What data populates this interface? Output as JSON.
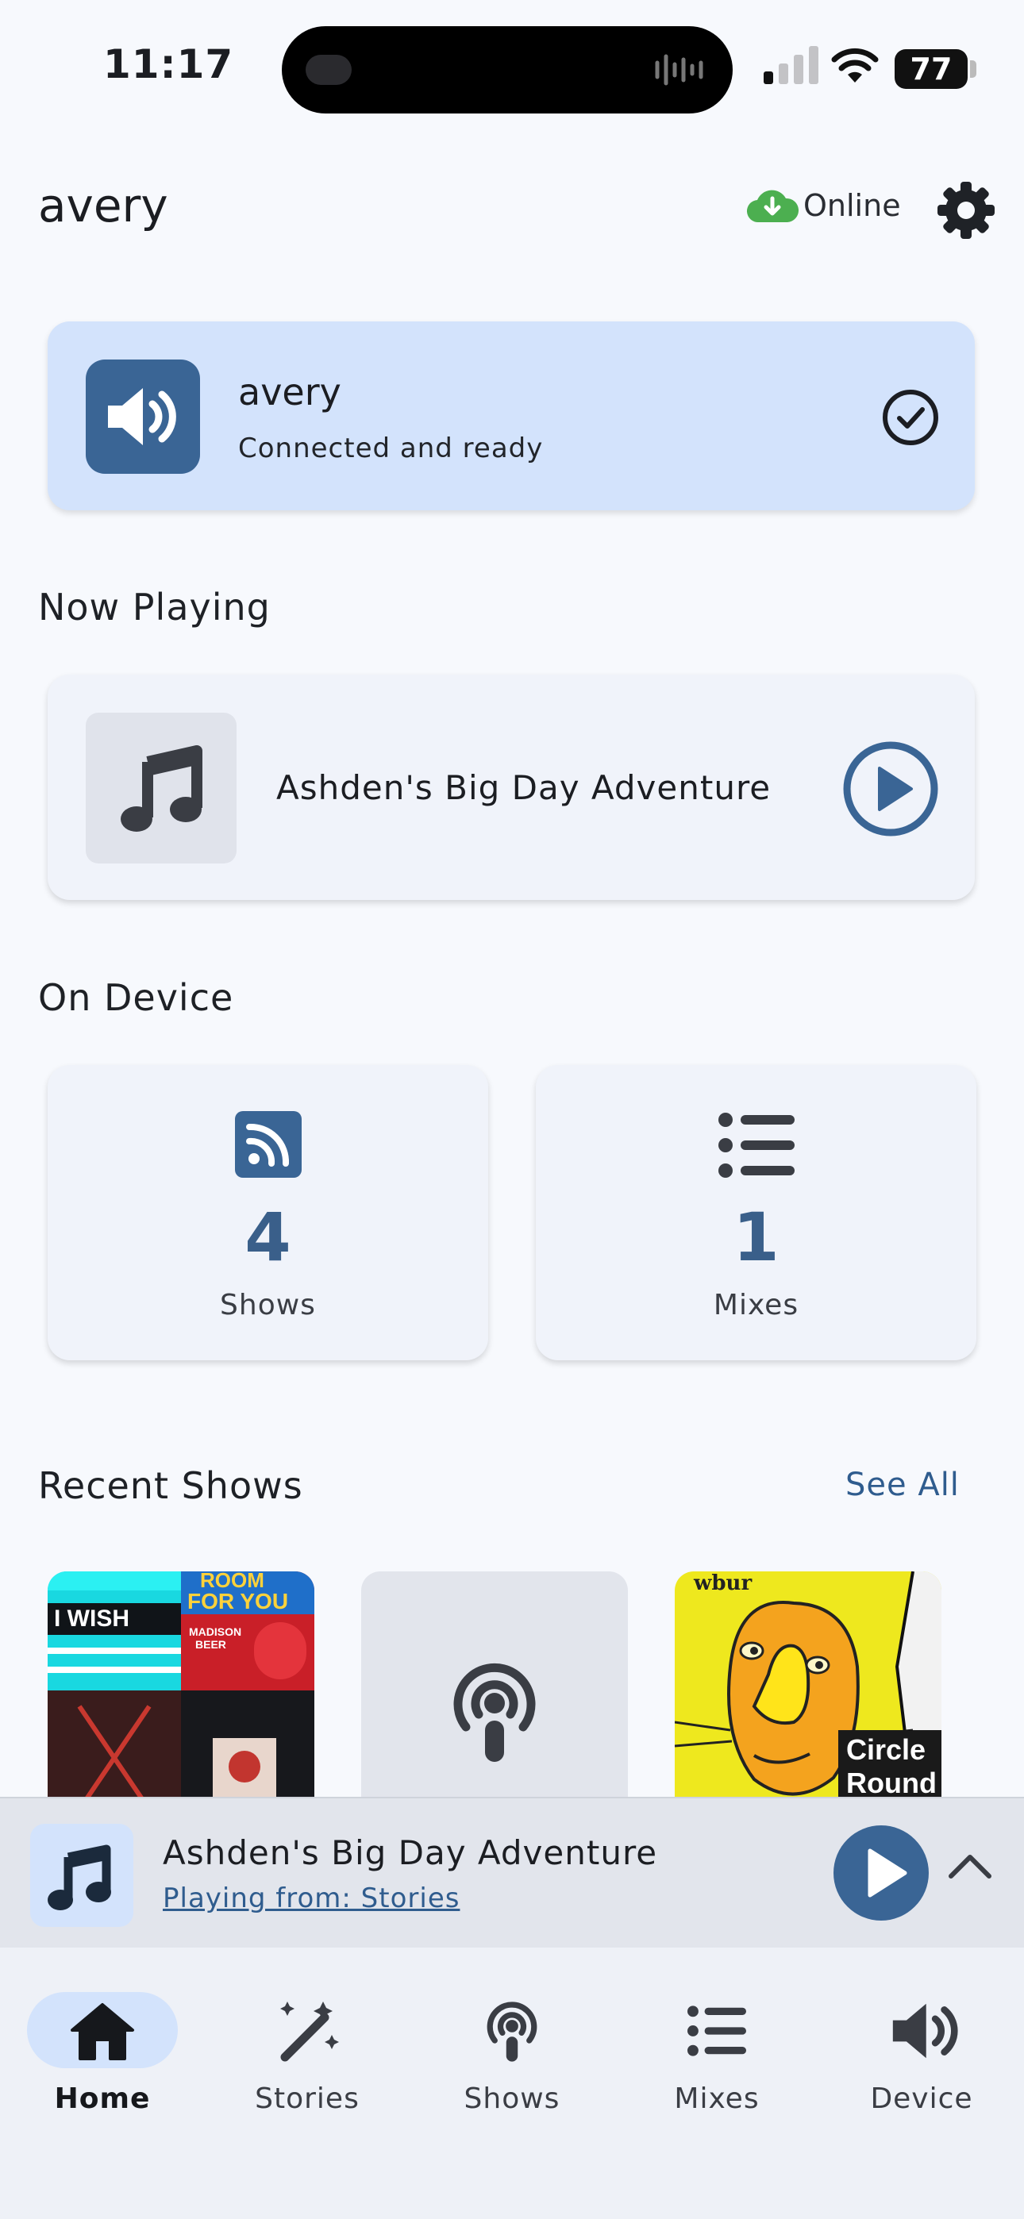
{
  "status_bar": {
    "time": "11:17",
    "battery": "77"
  },
  "header": {
    "title": "avery",
    "connection_status": "Online"
  },
  "device_card": {
    "name": "avery",
    "status": "Connected and ready"
  },
  "now_playing": {
    "section_title": "Now Playing",
    "track_title": "Ashden's Big Day Adventure"
  },
  "on_device": {
    "section_title": "On Device",
    "stats": [
      {
        "count": "4",
        "label": "Shows",
        "icon": "rss-icon"
      },
      {
        "count": "1",
        "label": "Mixes",
        "icon": "list-icon"
      }
    ]
  },
  "recent_shows": {
    "section_title": "Recent Shows",
    "see_all_label": "See All",
    "thumbnails": [
      {
        "tile_texts": [
          "I WISH",
          "ROOM",
          "FOR YOU",
          "MADISON",
          "BEER"
        ]
      },
      {
        "icon": "podcast-icon"
      },
      {
        "publisher": "wbur",
        "line1": "Circle",
        "line2": "Round"
      }
    ]
  },
  "mini_player": {
    "title": "Ashden's Big Day Adventure",
    "subtitle": "Playing from: Stories"
  },
  "bottom_nav": {
    "active": "Home",
    "items": [
      {
        "label": "Home",
        "icon": "home-icon"
      },
      {
        "label": "Stories",
        "icon": "magic-wand-icon"
      },
      {
        "label": "Shows",
        "icon": "podcast-icon"
      },
      {
        "label": "Mixes",
        "icon": "list-icon"
      },
      {
        "label": "Device",
        "icon": "speaker-icon"
      }
    ]
  },
  "colors": {
    "accent": "#3a6595",
    "accent_light": "#d3e3fc",
    "online_green": "#4caf50",
    "background": "#f7f9fd"
  }
}
